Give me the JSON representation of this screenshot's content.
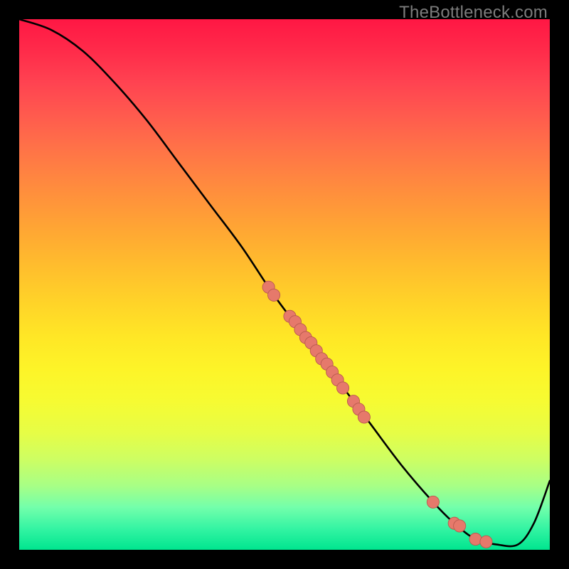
{
  "attribution": "TheBottleneck.com",
  "colors": {
    "curve": "#000000",
    "point_fill": "#e6796b",
    "point_stroke": "#b95a4e"
  },
  "chart_data": {
    "type": "line",
    "title": "",
    "xlabel": "",
    "ylabel": "",
    "xlim": [
      0,
      100
    ],
    "ylim": [
      0,
      100
    ],
    "grid": false,
    "legend": false,
    "annotations": [],
    "series": [
      {
        "name": "bottleneck-curve",
        "x": [
          0,
          6,
          12,
          18,
          24,
          30,
          36,
          42,
          48,
          54,
          60,
          66,
          72,
          78,
          82,
          86,
          90,
          94,
          97,
          100
        ],
        "y": [
          100,
          98,
          94,
          88,
          81,
          73,
          65,
          57,
          48,
          40,
          32,
          24,
          16,
          9,
          5,
          2,
          1,
          1,
          5,
          13
        ]
      }
    ],
    "scatter_points": {
      "name": "highlighted-points",
      "x": [
        47,
        48,
        51,
        52,
        53,
        54,
        55,
        56,
        57,
        58,
        59,
        60,
        61,
        63,
        64,
        65,
        78,
        82,
        83,
        86,
        88
      ],
      "y": [
        49.5,
        48,
        44,
        43,
        41.5,
        40,
        39,
        37.5,
        36,
        35,
        33.5,
        32,
        30.5,
        28,
        26.5,
        25,
        9,
        5,
        4.5,
        2,
        1.5
      ]
    }
  }
}
